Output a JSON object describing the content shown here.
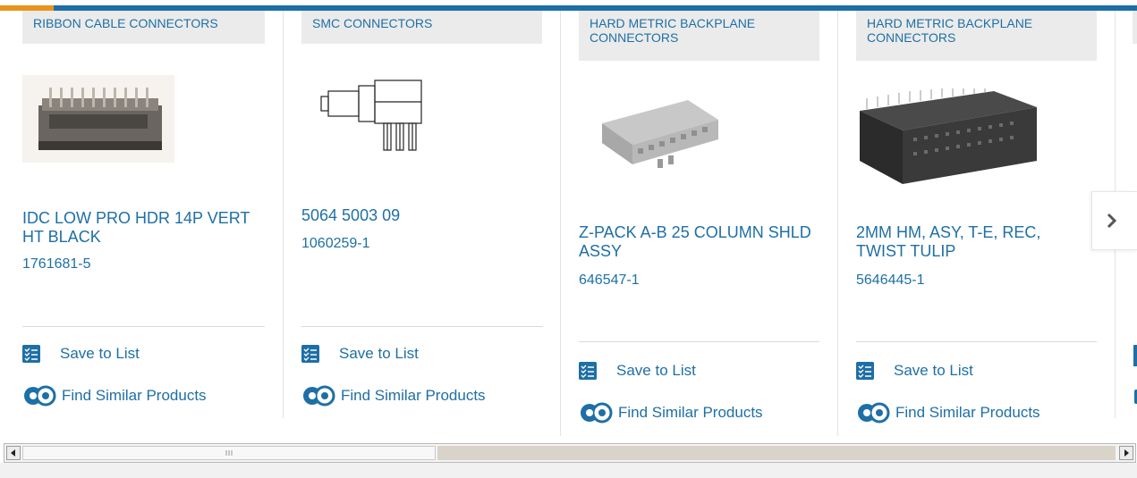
{
  "cards": [
    {
      "category": "RIBBON CABLE CONNECTORS",
      "title": "IDC LOW PRO HDR 14P VERT HT BLACK",
      "part_number": "1761681-5",
      "save_label": "Save to List",
      "similar_label": "Find Similar Products"
    },
    {
      "category": "SMC CONNECTORS",
      "title": "5064 5003 09",
      "part_number": "1060259-1",
      "save_label": "Save to List",
      "similar_label": "Find Similar Products"
    },
    {
      "category": "HARD METRIC BACKPLANE CONNECTORS",
      "title": "Z-PACK A-B 25 COLUMN SHLD ASSY",
      "part_number": "646547-1",
      "save_label": "Save to List",
      "similar_label": "Find Similar Products"
    },
    {
      "category": "HARD METRIC BACKPLANE CONNECTORS",
      "title": "2MM HM, ASY, T-E, REC, TWIST TULIP",
      "part_number": "5646445-1",
      "save_label": "Save to List",
      "similar_label": "Find Similar Products"
    }
  ],
  "carousel": {
    "next_icon": "chevron-right-icon"
  },
  "colors": {
    "brand_blue": "#1e6fa6",
    "accent_orange": "#e8941c",
    "tag_bg": "#ebebeb"
  }
}
